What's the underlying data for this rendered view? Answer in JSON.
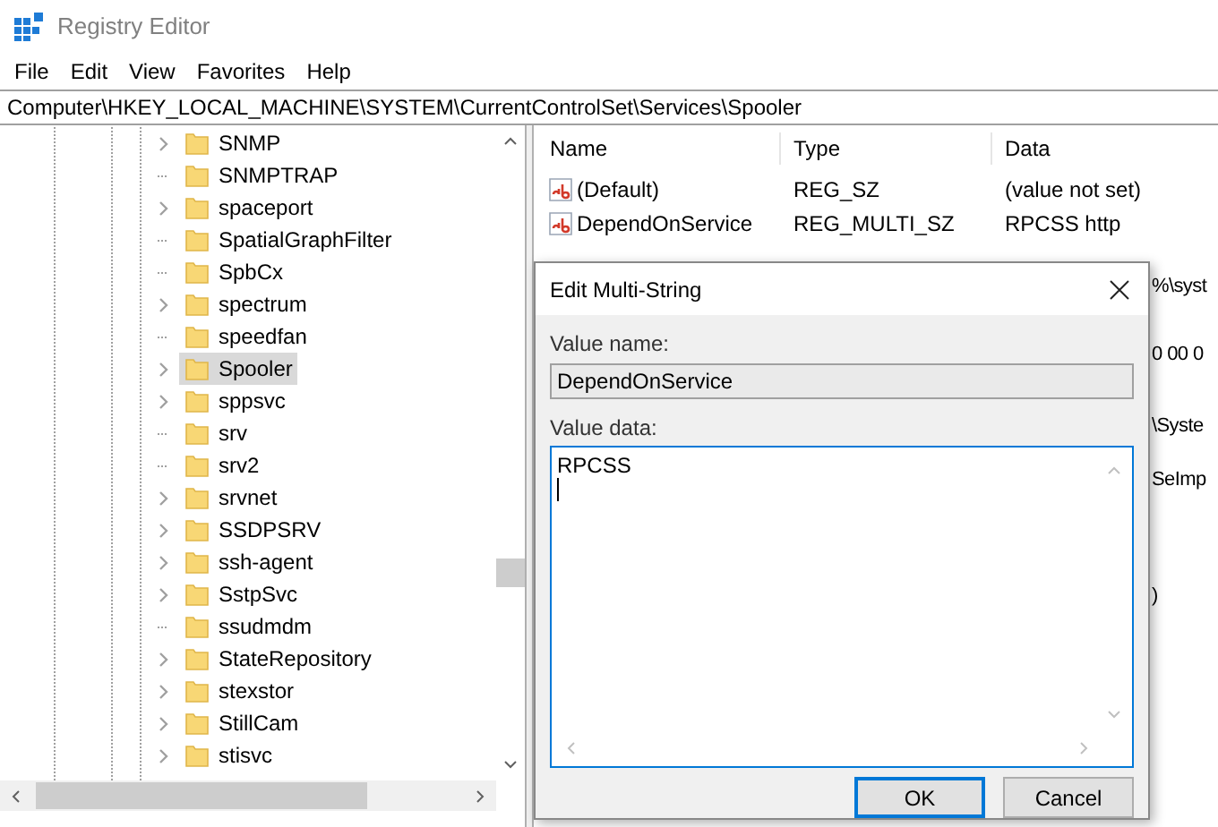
{
  "window": {
    "title": "Registry Editor"
  },
  "menu": [
    "File",
    "Edit",
    "View",
    "Favorites",
    "Help"
  ],
  "address": "Computer\\HKEY_LOCAL_MACHINE\\SYSTEM\\CurrentControlSet\\Services\\Spooler",
  "tree": [
    {
      "label": "SNMP",
      "expandable": true,
      "selected": false
    },
    {
      "label": "SNMPTRAP",
      "expandable": false,
      "selected": false
    },
    {
      "label": "spaceport",
      "expandable": true,
      "selected": false
    },
    {
      "label": "SpatialGraphFilter",
      "expandable": false,
      "selected": false
    },
    {
      "label": "SpbCx",
      "expandable": false,
      "selected": false
    },
    {
      "label": "spectrum",
      "expandable": true,
      "selected": false
    },
    {
      "label": "speedfan",
      "expandable": false,
      "selected": false
    },
    {
      "label": "Spooler",
      "expandable": true,
      "selected": true
    },
    {
      "label": "sppsvc",
      "expandable": true,
      "selected": false
    },
    {
      "label": "srv",
      "expandable": false,
      "selected": false
    },
    {
      "label": "srv2",
      "expandable": false,
      "selected": false
    },
    {
      "label": "srvnet",
      "expandable": true,
      "selected": false
    },
    {
      "label": "SSDPSRV",
      "expandable": true,
      "selected": false
    },
    {
      "label": "ssh-agent",
      "expandable": true,
      "selected": false
    },
    {
      "label": "SstpSvc",
      "expandable": true,
      "selected": false
    },
    {
      "label": "ssudmdm",
      "expandable": false,
      "selected": false
    },
    {
      "label": "StateRepository",
      "expandable": true,
      "selected": false
    },
    {
      "label": "stexstor",
      "expandable": true,
      "selected": false
    },
    {
      "label": "StillCam",
      "expandable": true,
      "selected": false
    },
    {
      "label": "stisvc",
      "expandable": true,
      "selected": false
    }
  ],
  "values": {
    "columns": [
      "Name",
      "Type",
      "Data"
    ],
    "rows": [
      {
        "name": "(Default)",
        "type": "REG_SZ",
        "data": "(value not set)"
      },
      {
        "name": "DependOnService",
        "type": "REG_MULTI_SZ",
        "data": "RPCSS http"
      }
    ],
    "covered_data": [
      "%\\syst",
      "0 00 0",
      "\\Syste",
      "SeImp",
      ")"
    ]
  },
  "dialog": {
    "title": "Edit Multi-String",
    "value_name_label": "Value name:",
    "value_name": "DependOnService",
    "value_data_label": "Value data:",
    "value_data": "RPCSS",
    "buttons": [
      {
        "label": "OK",
        "default": true
      },
      {
        "label": "Cancel",
        "default": false
      }
    ]
  }
}
